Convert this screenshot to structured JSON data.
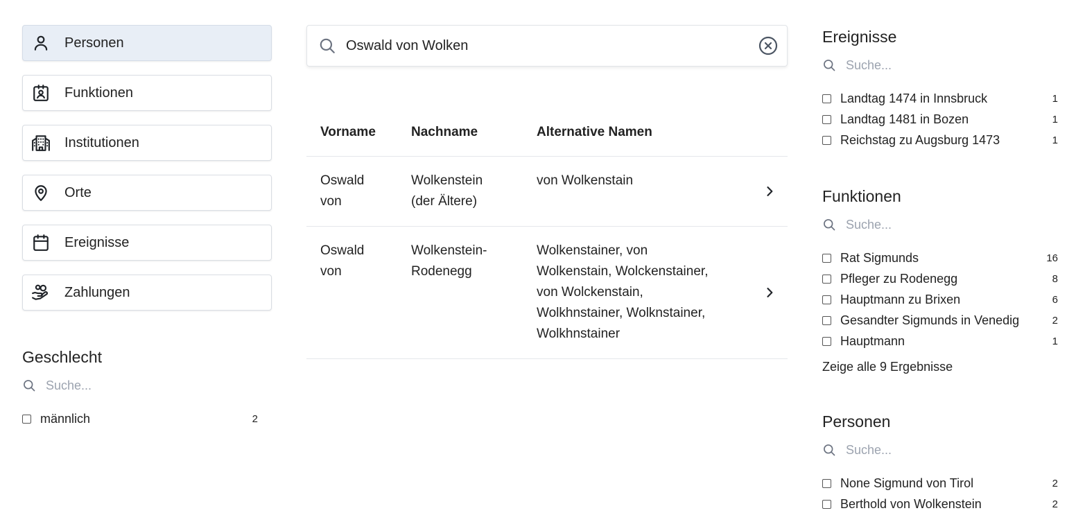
{
  "nav": {
    "items": [
      {
        "label": "Personen",
        "icon": "person-icon",
        "active": true
      },
      {
        "label": "Funktionen",
        "icon": "id-badge-icon",
        "active": false
      },
      {
        "label": "Institutionen",
        "icon": "building-icon",
        "active": false
      },
      {
        "label": "Orte",
        "icon": "map-pin-icon",
        "active": false
      },
      {
        "label": "Ereignisse",
        "icon": "calendar-icon",
        "active": false
      },
      {
        "label": "Zahlungen",
        "icon": "hand-coins-icon",
        "active": false
      }
    ]
  },
  "search": {
    "value": "Oswald von Wolken"
  },
  "results": {
    "headers": {
      "first_name": "Vorname",
      "last_name": "Nachname",
      "alt_names": "Alternative Namen"
    },
    "rows": [
      {
        "first_name_lines": [
          "Oswald",
          "von"
        ],
        "last_name_lines": [
          "Wolkenstein",
          "(der Ältere)"
        ],
        "alt_names_lines": [
          "von Wolkenstain"
        ]
      },
      {
        "first_name_lines": [
          "Oswald",
          "von"
        ],
        "last_name_lines": [
          "Wolkenstein-",
          "Rodenegg"
        ],
        "alt_names_lines": [
          "Wolkenstainer, von",
          "Wolkenstain, Wolckenstainer,",
          "von Wolckenstain,",
          "Wolkhnstainer, Wolknstainer,",
          "Wolkhnstainer"
        ]
      }
    ]
  },
  "facets": {
    "geschlecht": {
      "title": "Geschlecht",
      "search_placeholder": "Suche...",
      "items": [
        {
          "label": "männlich",
          "count": "2"
        }
      ]
    },
    "ereignisse": {
      "title": "Ereignisse",
      "search_placeholder": "Suche...",
      "items": [
        {
          "label": "Landtag 1474 in Innsbruck",
          "count": "1"
        },
        {
          "label": "Landtag 1481 in Bozen",
          "count": "1"
        },
        {
          "label": "Reichstag zu Augsburg 1473",
          "count": "1"
        }
      ]
    },
    "funktionen": {
      "title": "Funktionen",
      "search_placeholder": "Suche...",
      "items": [
        {
          "label": "Rat Sigmunds",
          "count": "16"
        },
        {
          "label": "Pfleger zu Rodenegg",
          "count": "8"
        },
        {
          "label": "Hauptmann zu Brixen",
          "count": "6"
        },
        {
          "label": "Gesandter Sigmunds in Venedig",
          "count": "2"
        },
        {
          "label": "Hauptmann",
          "count": "1"
        }
      ],
      "show_all": "Zeige alle 9 Ergebnisse"
    },
    "personen": {
      "title": "Personen",
      "search_placeholder": "Suche...",
      "items": [
        {
          "label": "None Sigmund von Tirol",
          "count": "2"
        },
        {
          "label": "Berthold von Wolkenstein",
          "count": "2"
        }
      ]
    }
  }
}
